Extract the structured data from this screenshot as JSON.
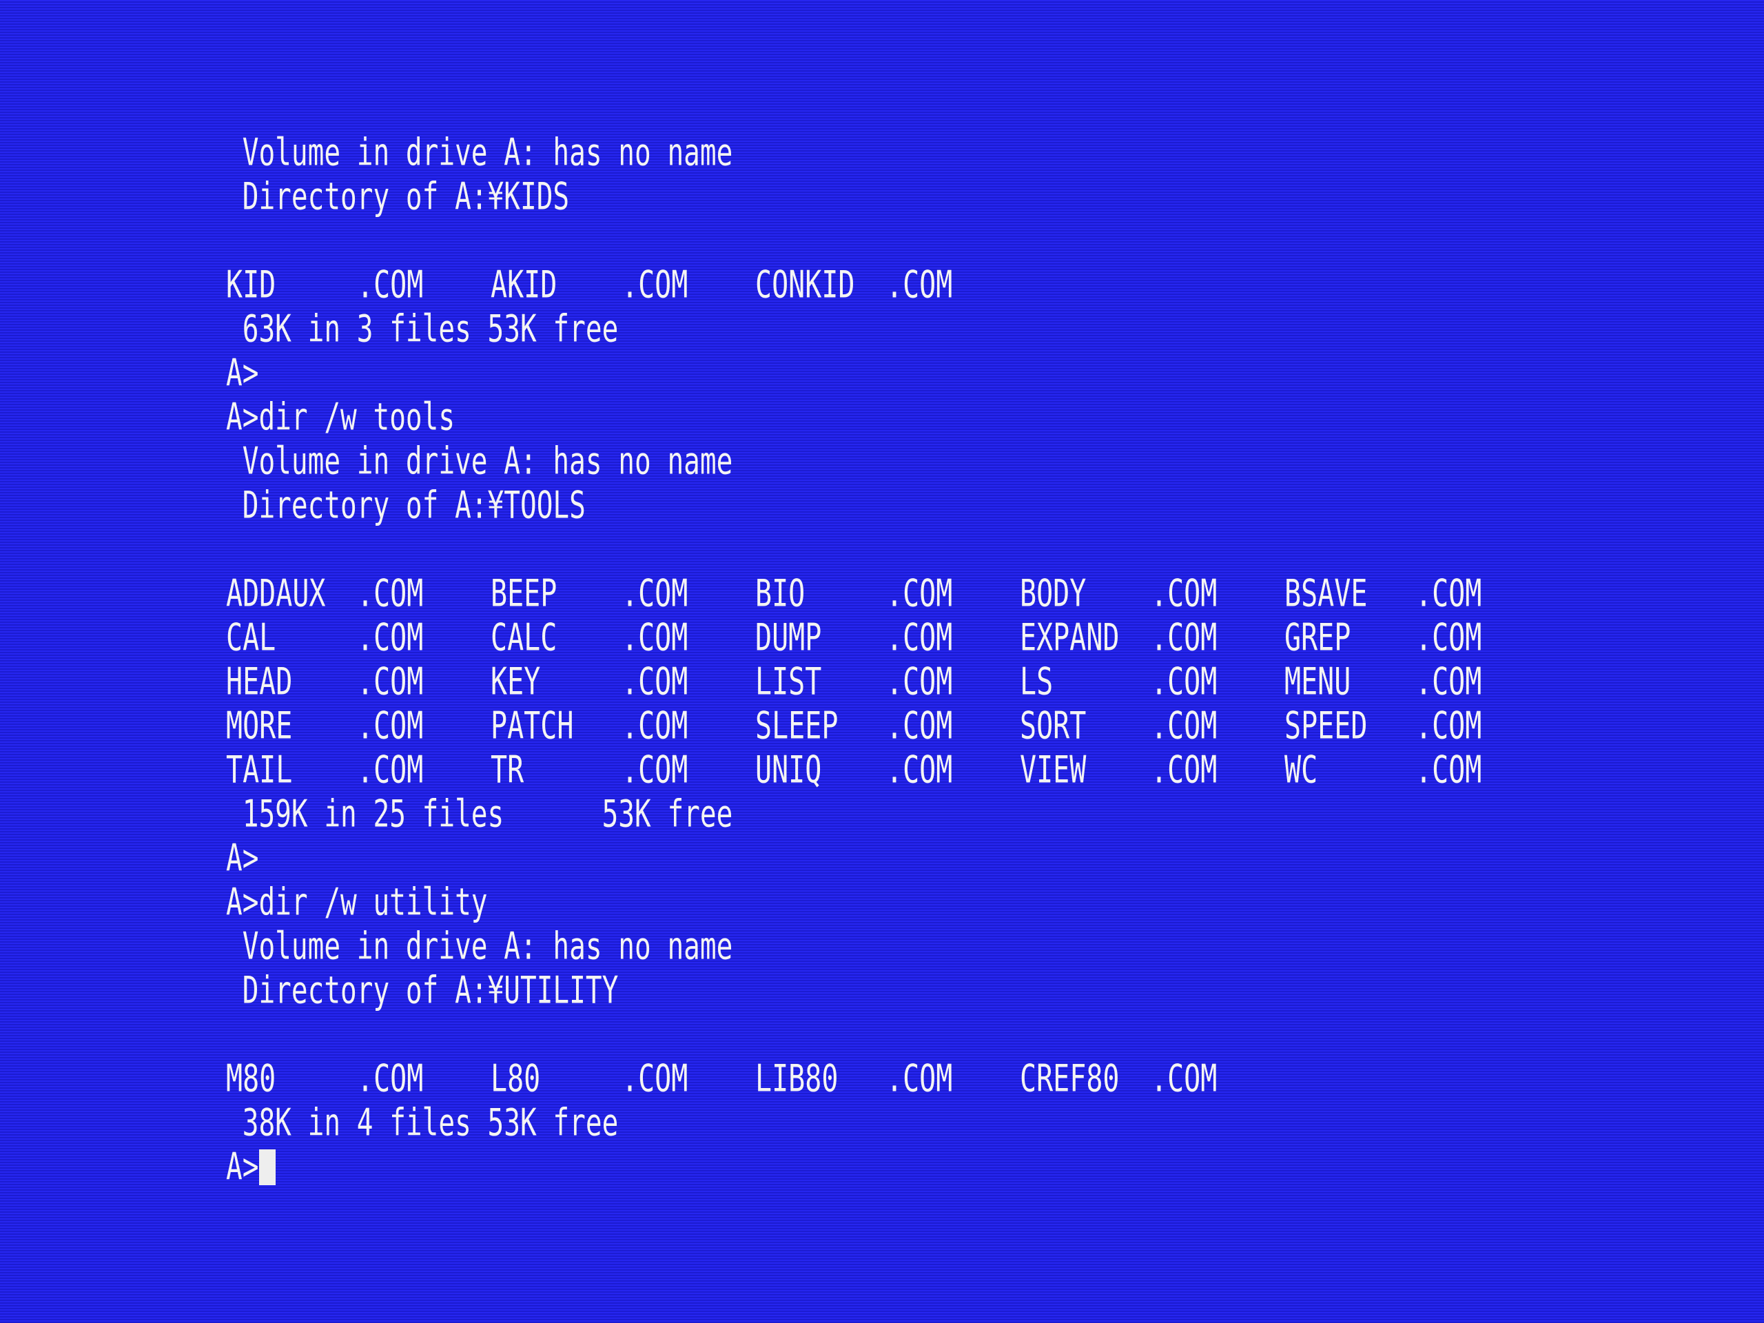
{
  "screen": {
    "background_color": "#2222ea",
    "text_color": "#f4f4f4"
  },
  "sessions": [
    {
      "command": "",
      "volume_line": " Volume in drive A: has no name",
      "directory_line": " Directory of A:¥KIDS",
      "files": [
        {
          "name": "KID",
          "ext": ".COM"
        },
        {
          "name": "AKID",
          "ext": ".COM"
        },
        {
          "name": "CONKID",
          "ext": ".COM"
        }
      ],
      "summary": " 63K in 3 files 53K free",
      "prompt_after": "A>"
    },
    {
      "command": "A>dir /w tools",
      "volume_line": " Volume in drive A: has no name",
      "directory_line": " Directory of A:¥TOOLS",
      "files": [
        {
          "name": "ADDAUX",
          "ext": ".COM"
        },
        {
          "name": "BEEP",
          "ext": ".COM"
        },
        {
          "name": "BIO",
          "ext": ".COM"
        },
        {
          "name": "BODY",
          "ext": ".COM"
        },
        {
          "name": "BSAVE",
          "ext": ".COM"
        },
        {
          "name": "CAL",
          "ext": ".COM"
        },
        {
          "name": "CALC",
          "ext": ".COM"
        },
        {
          "name": "DUMP",
          "ext": ".COM"
        },
        {
          "name": "EXPAND",
          "ext": ".COM"
        },
        {
          "name": "GREP",
          "ext": ".COM"
        },
        {
          "name": "HEAD",
          "ext": ".COM"
        },
        {
          "name": "KEY",
          "ext": ".COM"
        },
        {
          "name": "LIST",
          "ext": ".COM"
        },
        {
          "name": "LS",
          "ext": ".COM"
        },
        {
          "name": "MENU",
          "ext": ".COM"
        },
        {
          "name": "MORE",
          "ext": ".COM"
        },
        {
          "name": "PATCH",
          "ext": ".COM"
        },
        {
          "name": "SLEEP",
          "ext": ".COM"
        },
        {
          "name": "SORT",
          "ext": ".COM"
        },
        {
          "name": "SPEED",
          "ext": ".COM"
        },
        {
          "name": "TAIL",
          "ext": ".COM"
        },
        {
          "name": "TR",
          "ext": ".COM"
        },
        {
          "name": "UNIQ",
          "ext": ".COM"
        },
        {
          "name": "VIEW",
          "ext": ".COM"
        },
        {
          "name": "WC",
          "ext": ".COM"
        }
      ],
      "summary": " 159K in 25 files      53K free",
      "prompt_after": "A>"
    },
    {
      "command": "A>dir /w utility",
      "volume_line": " Volume in drive A: has no name",
      "directory_line": " Directory of A:¥UTILITY",
      "files": [
        {
          "name": "M80",
          "ext": ".COM"
        },
        {
          "name": "L80",
          "ext": ".COM"
        },
        {
          "name": "LIB80",
          "ext": ".COM"
        },
        {
          "name": "CREF80",
          "ext": ".COM"
        }
      ],
      "summary": " 38K in 4 files 53K free"
    }
  ],
  "current_prompt": "A>",
  "cursor": "block-cursor"
}
